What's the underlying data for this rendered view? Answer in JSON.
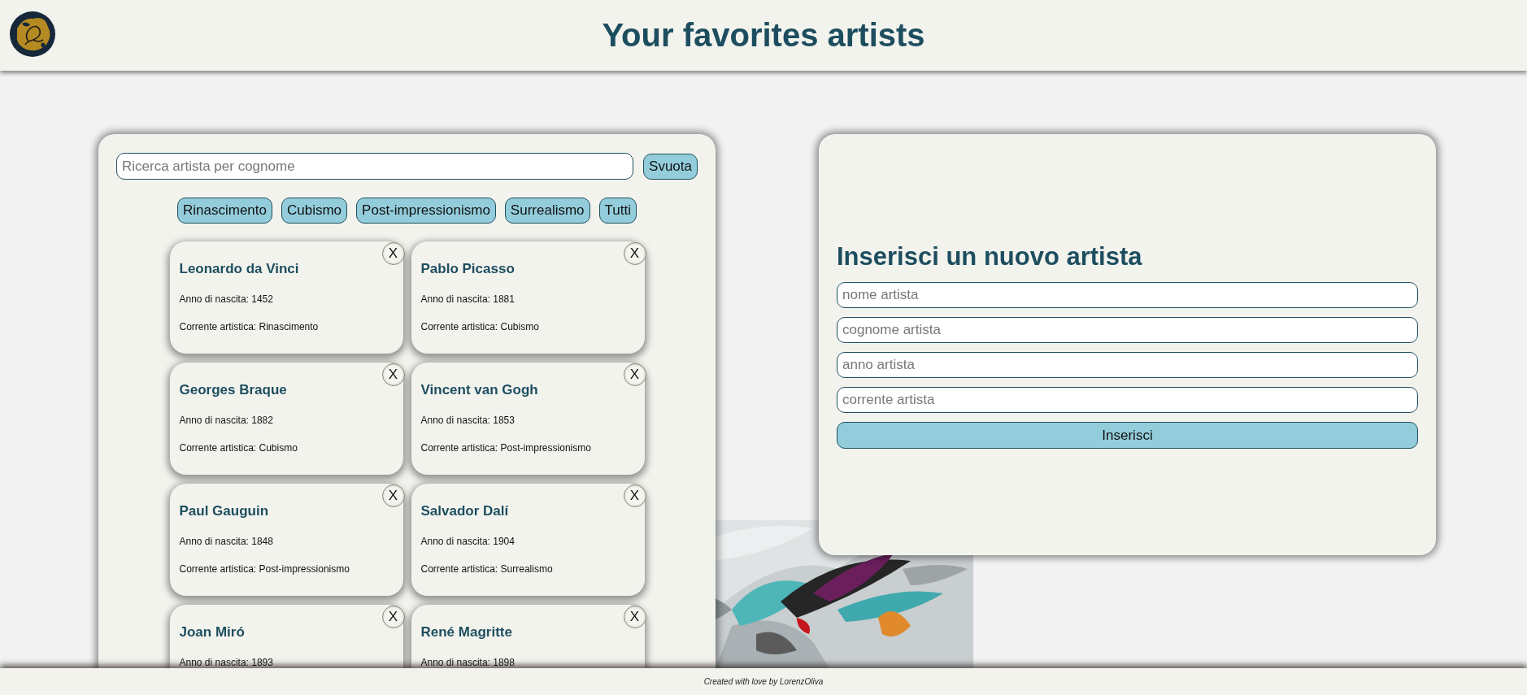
{
  "header": {
    "title": "Your favorites artists"
  },
  "search": {
    "placeholder": "Ricerca artista per cognome",
    "clear_button": "Svuota"
  },
  "filters": [
    {
      "label": "Rinascimento"
    },
    {
      "label": "Cubismo"
    },
    {
      "label": "Post-impressionismo"
    },
    {
      "label": "Surrealismo"
    },
    {
      "label": "Tutti"
    }
  ],
  "artists": [
    {
      "name": "Leonardo da Vinci",
      "birth": "Anno di nascita: 1452",
      "movement": "Corrente artistica: Rinascimento",
      "close": "X"
    },
    {
      "name": "Pablo Picasso",
      "birth": "Anno di nascita: 1881",
      "movement": "Corrente artistica: Cubismo",
      "close": "X"
    },
    {
      "name": "Georges Braque",
      "birth": "Anno di nascita: 1882",
      "movement": "Corrente artistica: Cubismo",
      "close": "X"
    },
    {
      "name": "Vincent van Gogh",
      "birth": "Anno di nascita: 1853",
      "movement": "Corrente artistica: Post-impressionismo",
      "close": "X"
    },
    {
      "name": "Paul Gauguin",
      "birth": "Anno di nascita: 1848",
      "movement": "Corrente artistica: Post-impressionismo",
      "close": "X"
    },
    {
      "name": "Salvador Dalí",
      "birth": "Anno di nascita: 1904",
      "movement": "Corrente artistica: Surrealismo",
      "close": "X"
    },
    {
      "name": "Joan Miró",
      "birth": "Anno di nascita: 1893",
      "close": "X"
    },
    {
      "name": "René Magritte",
      "birth": "Anno di nascita: 1898",
      "close": "X"
    }
  ],
  "form": {
    "title": "Inserisci un nuovo artista",
    "fields": [
      {
        "placeholder": "nome artista"
      },
      {
        "placeholder": "cognome artista"
      },
      {
        "placeholder": "anno artista"
      },
      {
        "placeholder": "corrente artista"
      }
    ],
    "submit": "Inserisci"
  },
  "footer": {
    "text": "Created with love by LorenzOliva"
  }
}
